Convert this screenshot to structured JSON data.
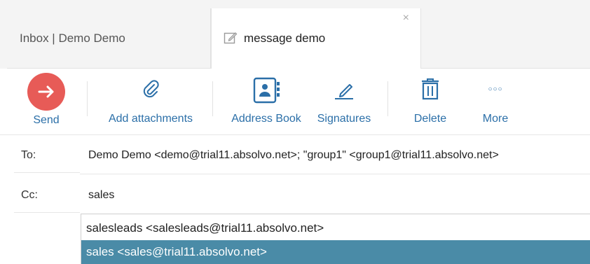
{
  "tabs": {
    "inbox_label": "Inbox | Demo Demo",
    "message_label": "message demo",
    "close_glyph": "×"
  },
  "toolbar": {
    "send": "Send",
    "add_attachments": "Add attachments",
    "address_book": "Address Book",
    "signatures": "Signatures",
    "delete": "Delete",
    "more": "More",
    "more_glyph": "○○○"
  },
  "fields": {
    "to_label": "To:",
    "to_value": "Demo Demo <demo@trial11.absolvo.net>; \"group1\" <group1@trial11.absolvo.net>",
    "cc_label": "Cc:",
    "cc_value": "sales"
  },
  "autocomplete": {
    "items": [
      {
        "text": "salesleads <salesleads@trial11.absolvo.net>",
        "selected": false
      },
      {
        "text": "sales <sales@trial11.absolvo.net>",
        "selected": true
      }
    ]
  },
  "colors": {
    "accent_blue": "#2b6fa8",
    "send_red": "#e75b57",
    "selected_row": "#4a8ba7"
  },
  "icons": [
    "edit-icon",
    "close-icon",
    "arrow-right-icon",
    "paperclip-icon",
    "address-book-icon",
    "signature-pen-icon",
    "trash-icon",
    "more-dots-icon"
  ]
}
